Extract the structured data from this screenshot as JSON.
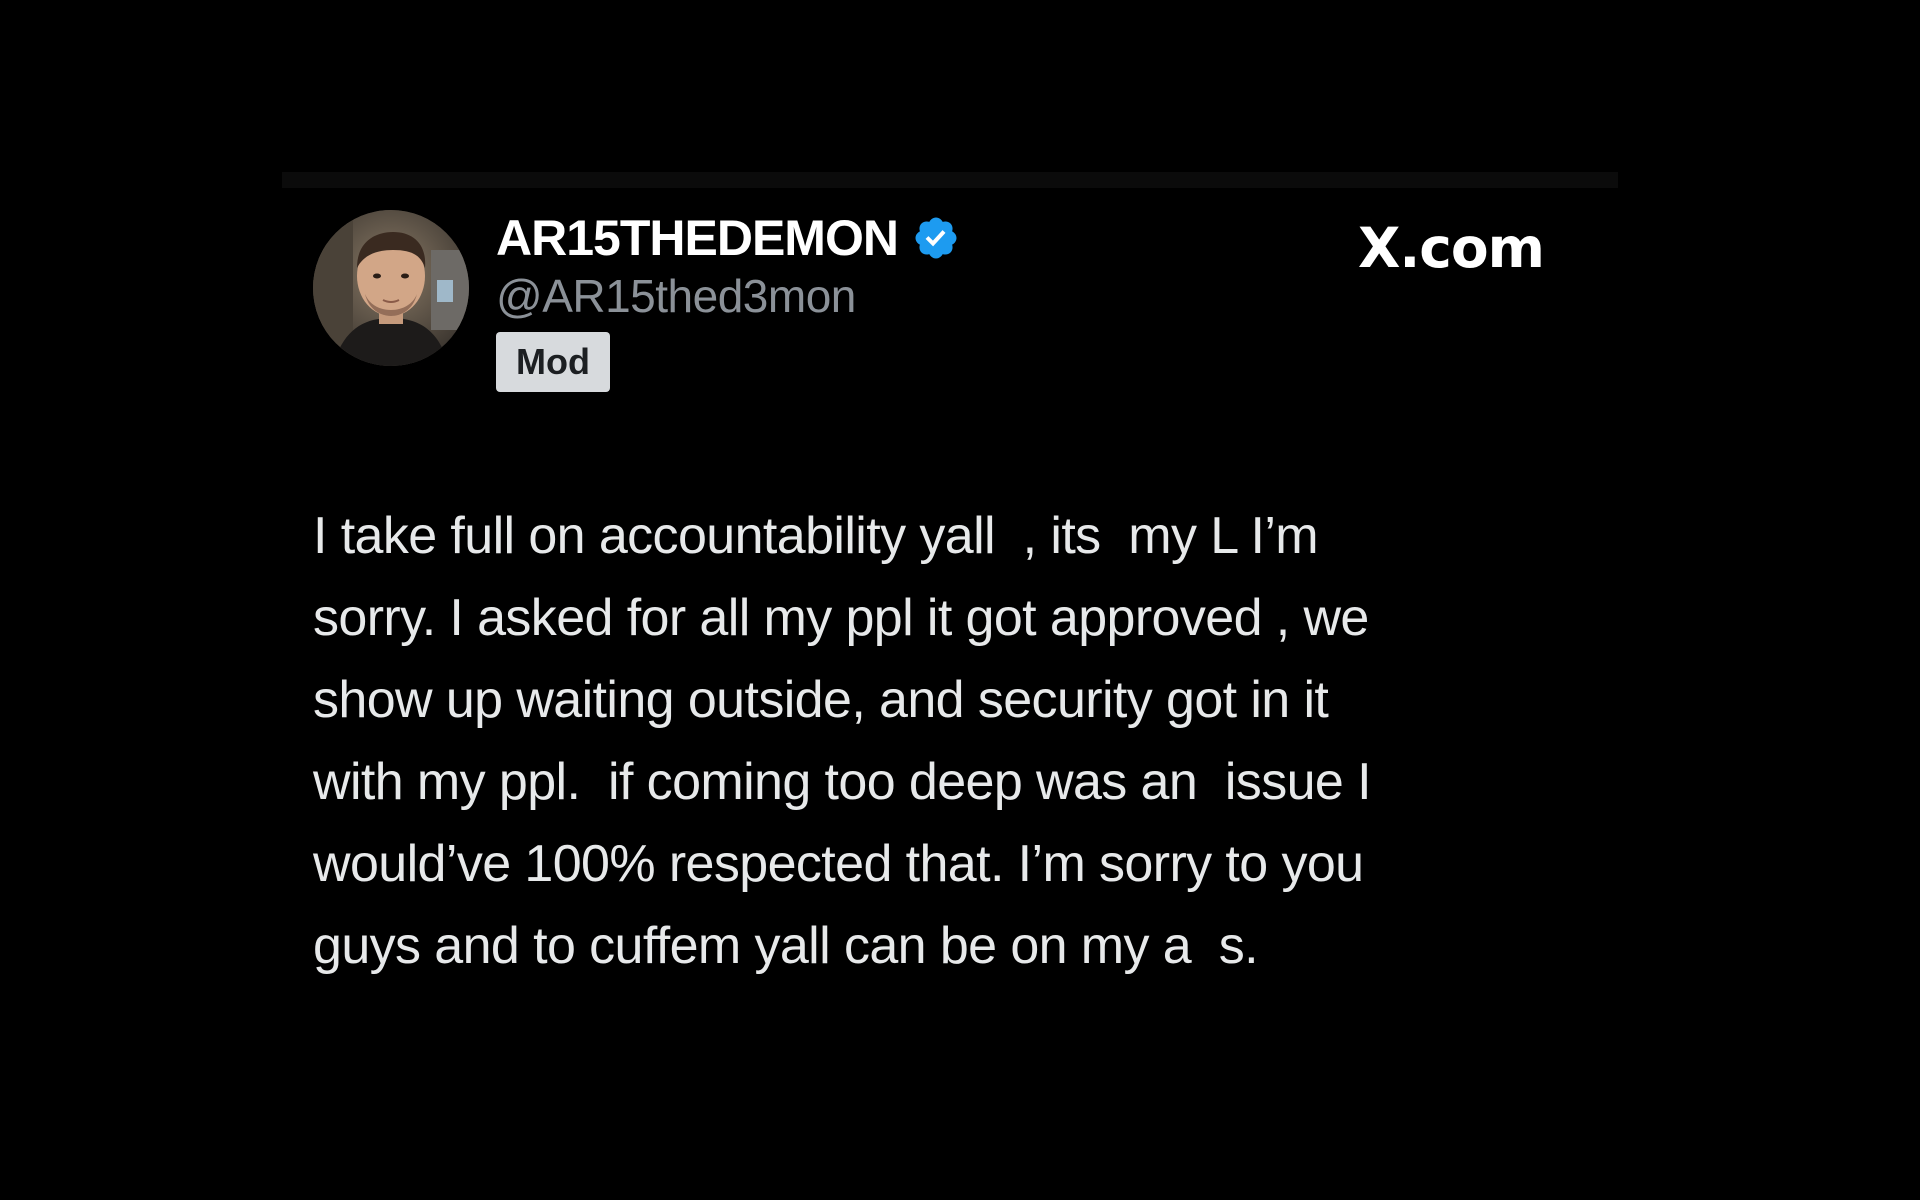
{
  "post": {
    "author": {
      "display_name": "AR15THEDEMON",
      "handle": "@AR15thed3mon",
      "badge": "Mod",
      "verified": true,
      "verified_color": "#1d9bf0"
    },
    "site_label": "X.com",
    "body_lines": [
      "I take full on accountability yall  , its  my L I’m",
      "sorry. I asked for all my ppl it got approved , we",
      "show up waiting outside, and security got in it",
      "with my ppl.  if coming too deep was an  issue I",
      "would’ve 100% respected that. I’m sorry to you",
      "guys and to cuffem yall can be on my a  s."
    ]
  },
  "colors": {
    "background": "#000000",
    "text": "#e7e9ea",
    "handle": "#8b9198",
    "badge_bg": "#d7dadd"
  }
}
